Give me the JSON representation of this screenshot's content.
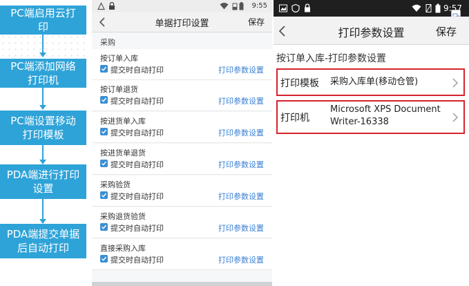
{
  "flowchart": {
    "steps": [
      "PC端启用云打印",
      "PC端添加网络打印机",
      "PC端设置移动打印模板",
      "PDA端进行打印设置",
      "PDA端提交单据后自动打印"
    ],
    "color": "#2ea3d8"
  },
  "screen1": {
    "status": {
      "time": "9:55"
    },
    "nav": {
      "title": "单据打印设置",
      "save_label": "保存"
    },
    "section": "采购",
    "items": [
      {
        "name": "按订单入库",
        "checkbox_label": "提交时自动打印",
        "checked": true,
        "link": "打印参数设置"
      },
      {
        "name": "按订单退货",
        "checkbox_label": "提交时自动打印",
        "checked": true,
        "link": "打印参数设置"
      },
      {
        "name": "按进货单入库",
        "checkbox_label": "提交时自动打印",
        "checked": true,
        "link": "打印参数设置"
      },
      {
        "name": "按进货单退货",
        "checkbox_label": "提交时自动打印",
        "checked": true,
        "link": "打印参数设置"
      },
      {
        "name": "采购验货",
        "checkbox_label": "提交时自动打印",
        "checked": true,
        "link": "打印参数设置"
      },
      {
        "name": "采购退货验货",
        "checkbox_label": "提交时自动打印",
        "checked": true,
        "link": "打印参数设置"
      },
      {
        "name": "直接采购入库",
        "checkbox_label": "提交时自动打印",
        "checked": true,
        "link": "打印参数设置"
      }
    ],
    "accent": "#3a7fd0"
  },
  "screen2": {
    "status": {
      "time": "9:57"
    },
    "nav": {
      "title": "打印参数设置",
      "save_label": "保存"
    },
    "subtitle": "按订单入库-打印参数设置",
    "template": {
      "label": "打印模板",
      "value": "采购入库单(移动仓管)"
    },
    "printer": {
      "label": "打印机",
      "value_line1": "Microsoft XPS Document",
      "value_line2": "Writer-16338"
    },
    "highlight": "#d6232a"
  }
}
